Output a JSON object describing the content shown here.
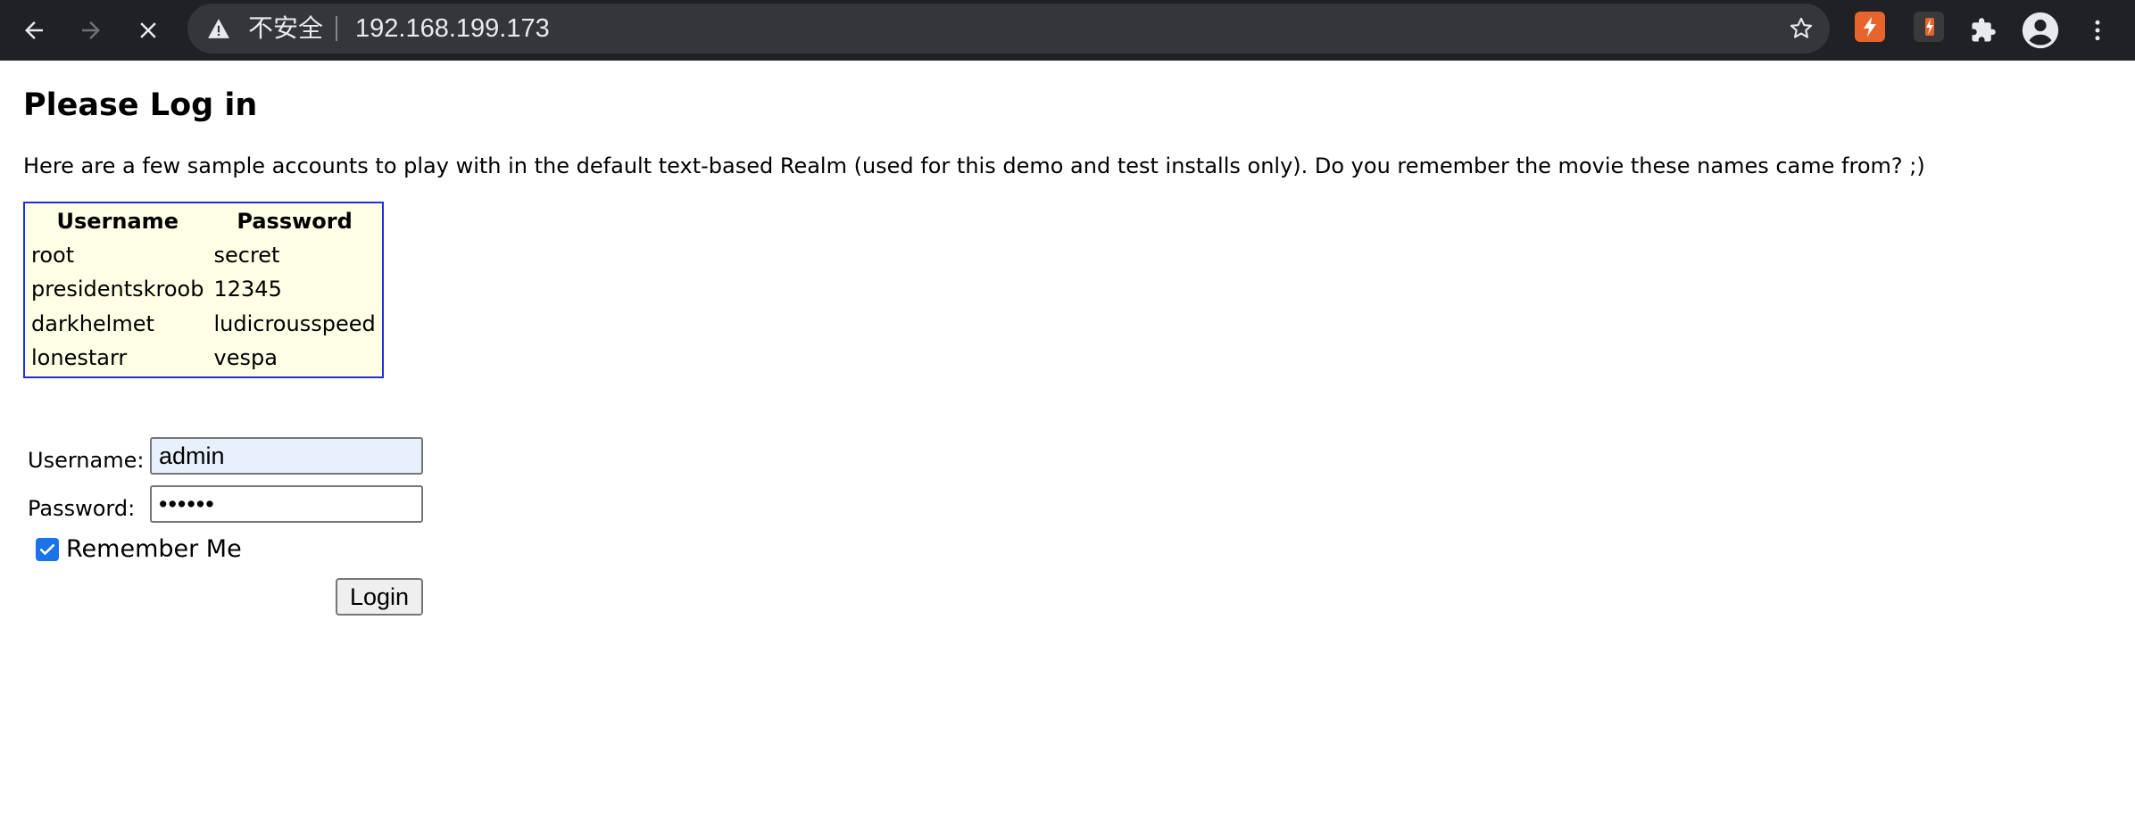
{
  "browser": {
    "security_label": "不安全",
    "url": "192.168.199.173",
    "icons": [
      "back-arrow-icon",
      "forward-arrow-icon",
      "stop-loading-icon",
      "warning-triangle-icon",
      "bookmark-star-icon",
      "extension-icon",
      "extension-icon",
      "puzzle-icon",
      "profile-icon",
      "kebab-menu-icon"
    ],
    "colors": {
      "chrome_bg": "#202124",
      "omnibox_bg": "#35363a",
      "ext_orange": "#e8642c"
    }
  },
  "page": {
    "title": "Please Log in",
    "intro": "Here are a few sample accounts to play with in the default text-based Realm (used for this demo and test installs only). Do you remember the movie these names came from? ;)"
  },
  "accounts": {
    "headers": [
      "Username",
      "Password"
    ],
    "rows": [
      [
        "root",
        "secret"
      ],
      [
        "presidentskroob",
        "12345"
      ],
      [
        "darkhelmet",
        "ludicrousspeed"
      ],
      [
        "lonestarr",
        "vespa"
      ]
    ],
    "colors": {
      "border": "#1f2ee0",
      "background": "#ffffe6"
    }
  },
  "form": {
    "username_label": "Username:",
    "username_value": "admin",
    "password_label": "Password:",
    "password_value": "••••••",
    "remember_label": "Remember Me",
    "remember_checked": true,
    "login_button": "Login"
  }
}
